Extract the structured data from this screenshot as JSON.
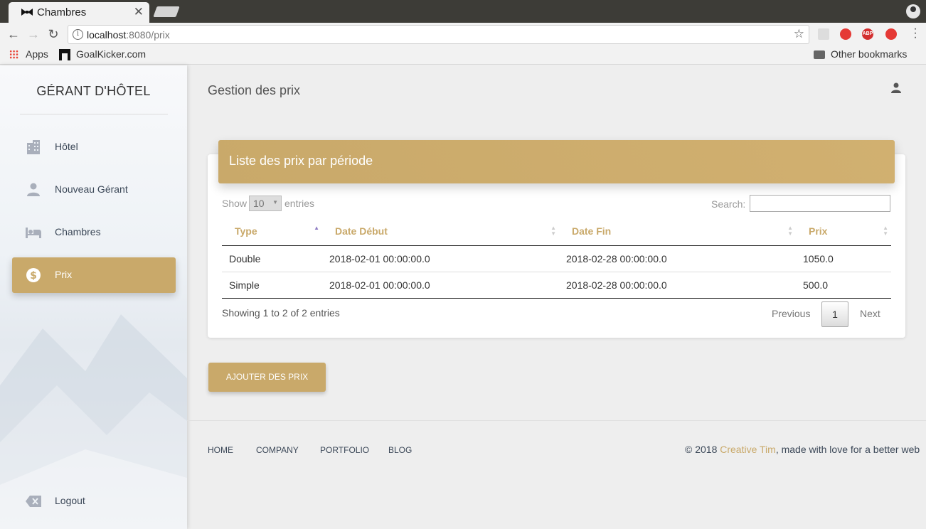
{
  "browser": {
    "tab_title": "Chambres",
    "url_host": "localhost",
    "url_rest": ":8080/prix",
    "bookmarks": [
      {
        "label": "Apps"
      },
      {
        "label": "GoalKicker.com"
      }
    ],
    "other_bookmarks": "Other bookmarks",
    "extensions": [
      "ABP"
    ]
  },
  "sidebar": {
    "brand": "GÉRANT D'HÔTEL",
    "items": [
      {
        "label": "Hôtel",
        "icon": "building-icon"
      },
      {
        "label": "Nouveau Gérant",
        "icon": "person-icon"
      },
      {
        "label": "Chambres",
        "icon": "hotel-bed-icon"
      },
      {
        "label": "Prix",
        "icon": "dollar-icon",
        "active": true
      }
    ],
    "logout": "Logout"
  },
  "main": {
    "title": "Gestion des prix",
    "card_title": "Liste des prix par période",
    "length": {
      "show": "Show",
      "value": "10",
      "entries": "entries"
    },
    "search_label": "Search:",
    "search_value": "",
    "columns": [
      "Type",
      "Date Début",
      "Date Fin",
      "Prix"
    ],
    "rows": [
      [
        "Double",
        "2018-02-01 00:00:00.0",
        "2018-02-28 00:00:00.0",
        "1050.0"
      ],
      [
        "Simple",
        "2018-02-01 00:00:00.0",
        "2018-02-28 00:00:00.0",
        "500.0"
      ]
    ],
    "info": "Showing 1 to 2 of 2 entries",
    "pagination": {
      "previous": "Previous",
      "current": "1",
      "next": "Next"
    },
    "add_button": "AJOUTER DES PRIX"
  },
  "footer": {
    "links": [
      "HOME",
      "COMPANY",
      "PORTFOLIO",
      "BLOG"
    ],
    "copyright_prefix": "© 2018 ",
    "copyright_link": "Creative Tim",
    "copyright_suffix": ", made with love for a better web"
  },
  "colors": {
    "accent": "#c9a96a",
    "text": "#3c4858"
  }
}
